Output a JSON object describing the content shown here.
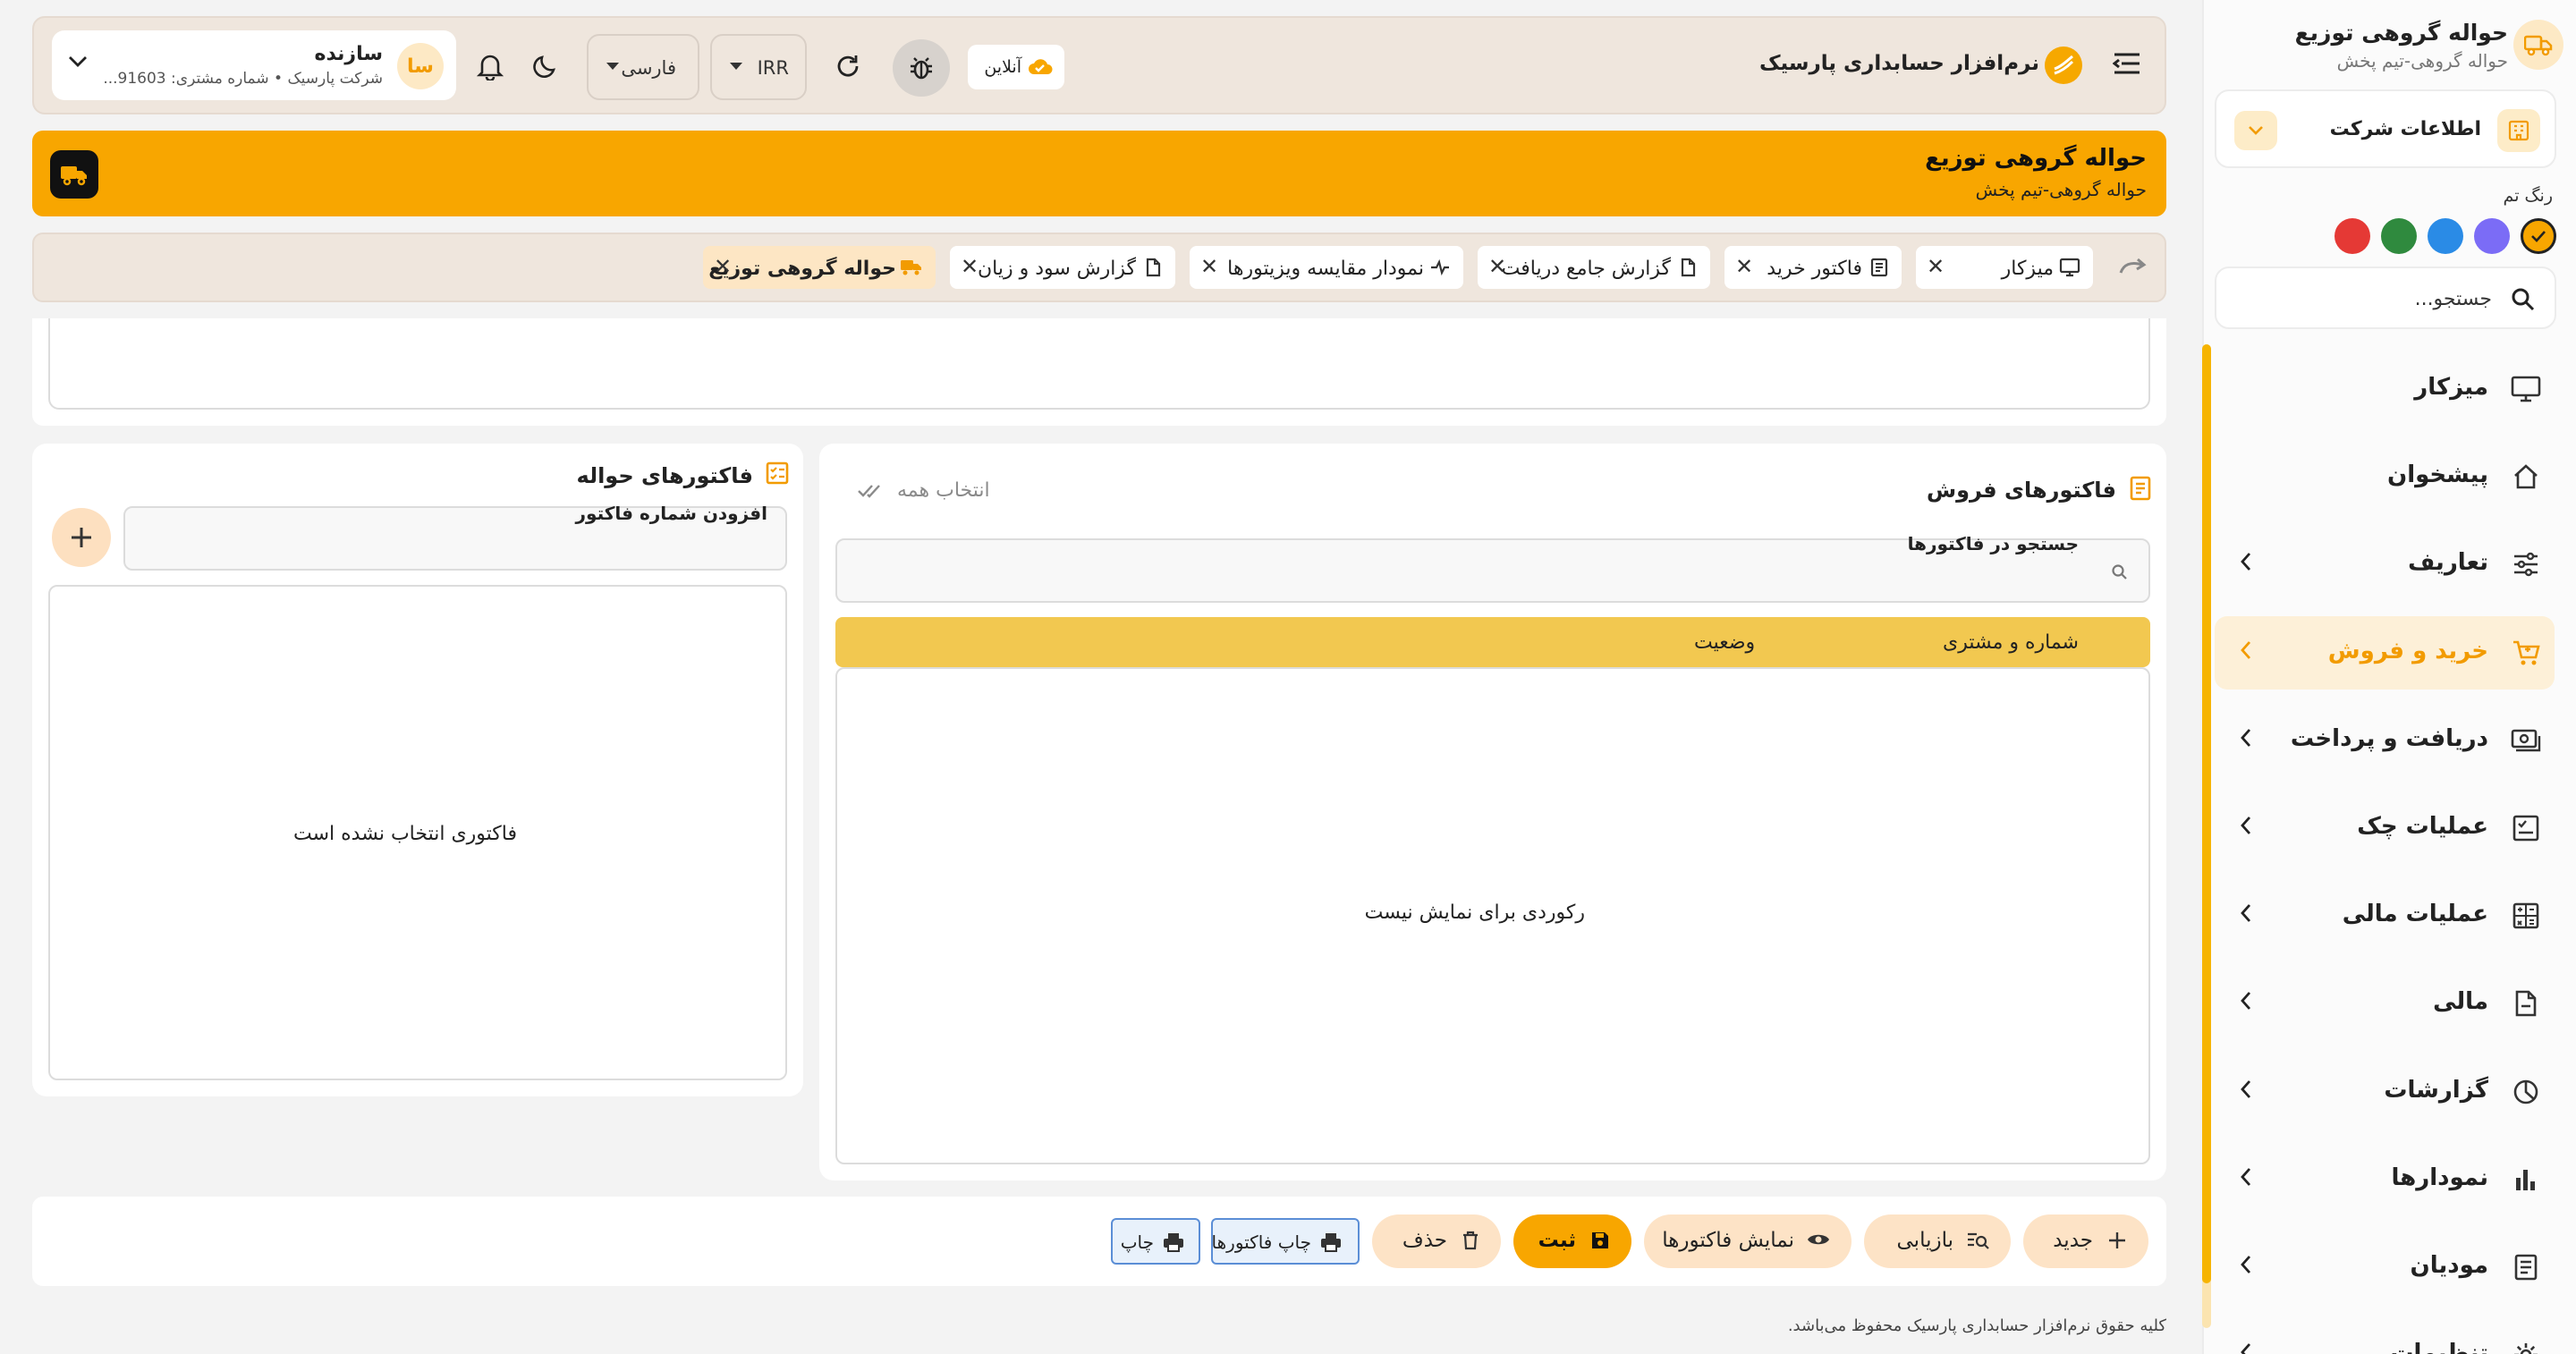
{
  "sidebar": {
    "title": "حواله گروهی توزیع",
    "subtitle": "حواله گروهی-تیم پخش",
    "company_label": "اطلاعات شرکت",
    "theme_label": "رنگ تم",
    "theme_colors": [
      "#f8a600",
      "#7b6cf6",
      "#2a8be6",
      "#2f8a3e",
      "#e53935"
    ],
    "search_placeholder": "جستجو...",
    "items": [
      {
        "label": "میزکار",
        "icon": "monitor-icon",
        "has_children": false,
        "active": false
      },
      {
        "label": "پیشخوان",
        "icon": "home-icon",
        "has_children": false,
        "active": false
      },
      {
        "label": "تعاریف",
        "icon": "sliders-icon",
        "has_children": true,
        "active": false
      },
      {
        "label": "خرید و فروش",
        "icon": "cart-icon",
        "has_children": true,
        "active": true
      },
      {
        "label": "دریافت و پرداخت",
        "icon": "cash-icon",
        "has_children": true,
        "active": false
      },
      {
        "label": "عملیات چک",
        "icon": "check-list-icon",
        "has_children": true,
        "active": false
      },
      {
        "label": "عملیات مالی",
        "icon": "calculator-icon",
        "has_children": true,
        "active": false
      },
      {
        "label": "مالی",
        "icon": "document-icon",
        "has_children": true,
        "active": false
      },
      {
        "label": "گزارشات",
        "icon": "pie-chart-icon",
        "has_children": true,
        "active": false
      },
      {
        "label": "نمودارها",
        "icon": "bar-chart-icon",
        "has_children": true,
        "active": false
      },
      {
        "label": "مودیان",
        "icon": "receipt-icon",
        "has_children": true,
        "active": false
      },
      {
        "label": "تنظیمات",
        "icon": "gear-icon",
        "has_children": true,
        "active": false
      }
    ]
  },
  "header": {
    "app_name": "نرم‌افزار حسابداری پارسیک",
    "status": "آنلاین",
    "currency": "IRR",
    "language": "فارسی",
    "user": {
      "avatar": "سا",
      "name": "سازنده",
      "details": "شرکت پارسیک • شماره مشتری: 91603..."
    }
  },
  "banner": {
    "title": "حواله گروهی توزیع",
    "subtitle": "حواله گروهی-تیم پخش"
  },
  "tabs": [
    {
      "label": "میزکار",
      "icon": "monitor-icon",
      "active": false
    },
    {
      "label": "فاکتور خرید",
      "icon": "receipt-icon",
      "active": false
    },
    {
      "label": "گزارش جامع دریافت",
      "icon": "file-icon",
      "active": false
    },
    {
      "label": "نمودار مقایسه ویزیتورها",
      "icon": "compare-icon",
      "active": false
    },
    {
      "label": "گزارش سود و زیان",
      "icon": "file-icon",
      "active": false
    },
    {
      "label": "حواله گروهی توزیع",
      "icon": "truck-icon",
      "active": true
    }
  ],
  "sales": {
    "title": "فاکتورهای فروش",
    "select_all": "انتخاب همه",
    "search_label": "جستجو در فاکتورها",
    "columns": [
      "شماره و مشتری",
      "وضعیت"
    ],
    "empty": "رکوردی برای نمایش نیست"
  },
  "havale": {
    "title": "فاکتورهای حواله",
    "add_label": "افزودن شماره فاکتور",
    "empty": "فاکتوری انتخاب نشده است"
  },
  "actions": {
    "new": "جدید",
    "retrieve": "بازیابی",
    "show_invoices": "نمایش فاکتورها",
    "save": "ثبت",
    "delete": "حذف",
    "print_invoices": "چاپ فاکتورها",
    "print": "چاپ"
  },
  "footer": "کلیه حقوق نرم‌افزار حسابداری پارسیک محفوظ می‌باشد."
}
